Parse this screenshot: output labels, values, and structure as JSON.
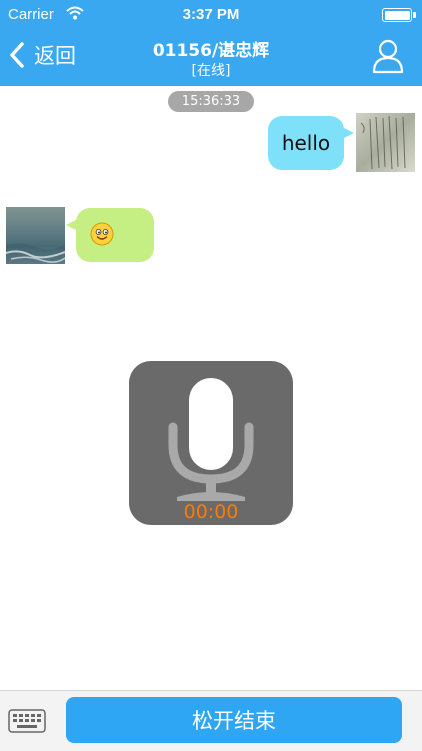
{
  "status_bar": {
    "carrier": "Carrier",
    "time": "3:37 PM",
    "icons": [
      "wifi-icon",
      "battery-icon"
    ]
  },
  "nav": {
    "back_label": "返回",
    "title": "01156/谌忠辉",
    "subtitle": "[在线]",
    "right_icon": "user-icon",
    "background": "#3aa8f0"
  },
  "chat": {
    "timestamp": "15:36:33",
    "messages": [
      {
        "side": "right",
        "text": "hello",
        "bubble_color": "#7fe0fa"
      },
      {
        "side": "left",
        "content_icon": "smiley-emoji-icon",
        "bubble_color": "#c6ef83"
      }
    ]
  },
  "recorder": {
    "elapsed": "00:00",
    "icon": "microphone-icon",
    "time_color": "#ff7a00"
  },
  "bottom_bar": {
    "keyboard_icon": "keyboard-icon",
    "release_label": "松开结束",
    "button_color": "#2ea6f3"
  }
}
